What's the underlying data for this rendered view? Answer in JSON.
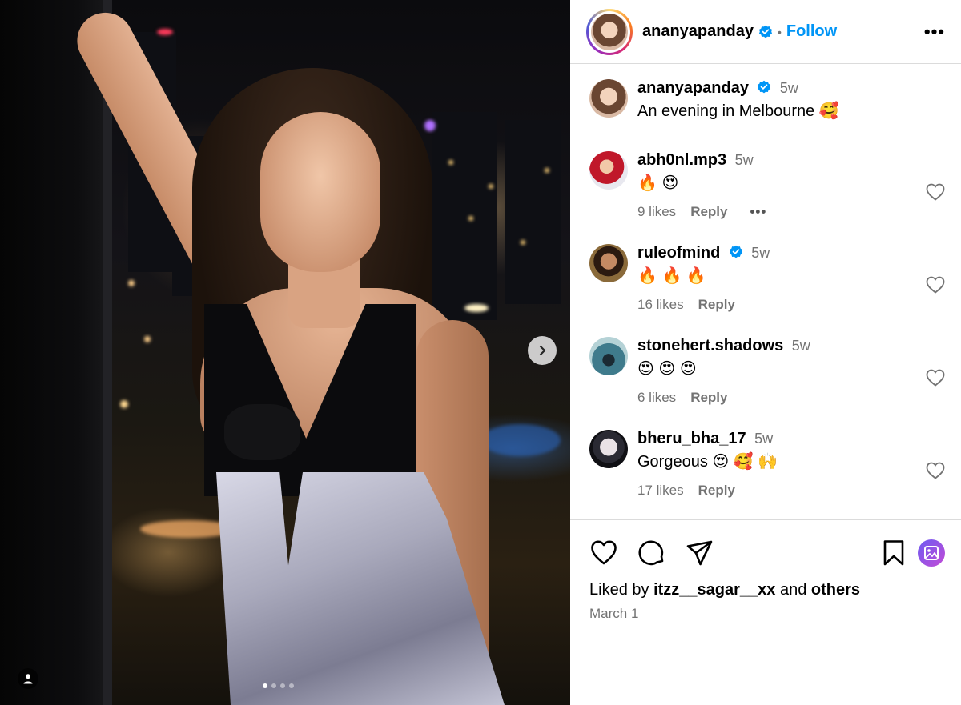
{
  "post": {
    "username": "ananyapanday",
    "follow_label": "Follow",
    "separator": "•",
    "more_label": "•••"
  },
  "caption": {
    "username": "ananyapanday",
    "time": "5w",
    "text": "An evening in Melbourne 🥰"
  },
  "comments": [
    {
      "username": "abh0nl.mp3",
      "verified": false,
      "time": "5w",
      "text": "🔥 😍",
      "likes": "9 likes",
      "reply": "Reply",
      "more": "•••"
    },
    {
      "username": "ruleofmind",
      "verified": true,
      "time": "5w",
      "text": "🔥 🔥 🔥",
      "likes": "16 likes",
      "reply": "Reply"
    },
    {
      "username": "stonehert.shadows",
      "verified": false,
      "time": "5w",
      "text": "😍 😍 😍",
      "likes": "6 likes",
      "reply": "Reply"
    },
    {
      "username": "bheru_bha_17",
      "verified": false,
      "time": "5w",
      "text": "Gorgeous 😍 🥰 🙌",
      "likes": "17 likes",
      "reply": "Reply"
    }
  ],
  "engagement": {
    "liked_prefix": "Liked by",
    "liked_user": "itzz__sagar__xx",
    "liked_and": "and",
    "liked_others": "others",
    "date": "March 1"
  },
  "carousel": {
    "total": 4,
    "active": 1
  },
  "icons": {
    "verified": "verified-badge-icon",
    "like": "heart-icon",
    "comment": "comment-icon",
    "share": "share-icon",
    "save": "bookmark-icon",
    "next": "chevron-right-icon",
    "tag": "user-tag-icon",
    "gallery": "gallery-icon"
  },
  "colors": {
    "link": "#0095f6",
    "verified": "#0095f6",
    "muted": "#737373",
    "divider": "#dbdbdb"
  }
}
